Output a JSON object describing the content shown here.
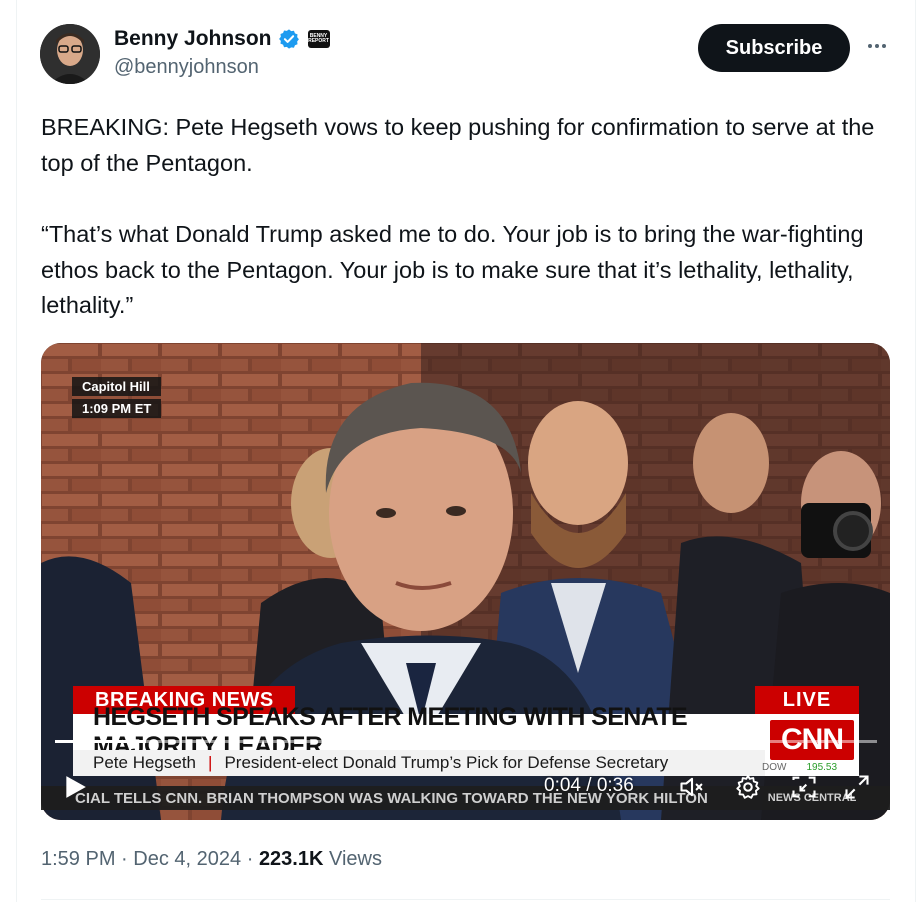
{
  "author": {
    "name": "Benny Johnson",
    "handle": "@bennyjohnson",
    "verified_color": "#1d9bf0",
    "affiliate_badge_text": "BENNY REPORT"
  },
  "actions": {
    "subscribe_label": "Subscribe",
    "more_icon": "more-horizontal-icon"
  },
  "tweet": {
    "paragraph1": "BREAKING: Pete Hegseth vows to keep pushing for confirmation to serve at the top of the Pentagon.",
    "paragraph2": "“That’s what Donald Trump asked me to do. Your job is to bring the war-fighting ethos back to the Pentagon. Your job is to make sure that it’s lethality, lethality, lethality.”"
  },
  "video": {
    "location": "Capitol Hill",
    "location_time": "1:09 PM ET",
    "breaking_label": "BREAKING NEWS",
    "live_label": "LIVE",
    "headline": "HEGSETH SPEAKS AFTER MEETING WITH SENATE MAJORITY LEADER",
    "speaker": "Pete Hegseth",
    "speaker_title": "President-elect Donald Trump’s Pick for Defense Secretary",
    "network": "CNN",
    "market": "DOW",
    "market_value": "195.53",
    "ticker": "CIAL TELLS CNN. BRIAN THOMPSON WAS WALKING TOWARD THE NEW YORK HILTON",
    "ticker_tail": "NEWS CENTRAL",
    "time_display": "0:04 / 0:36",
    "progress": 0.111,
    "brand_red": "#cc0000"
  },
  "meta": {
    "time": "1:59 PM",
    "separator": "·",
    "date": "Dec 4, 2024",
    "views_count": "223.1K",
    "views_label": "Views"
  }
}
